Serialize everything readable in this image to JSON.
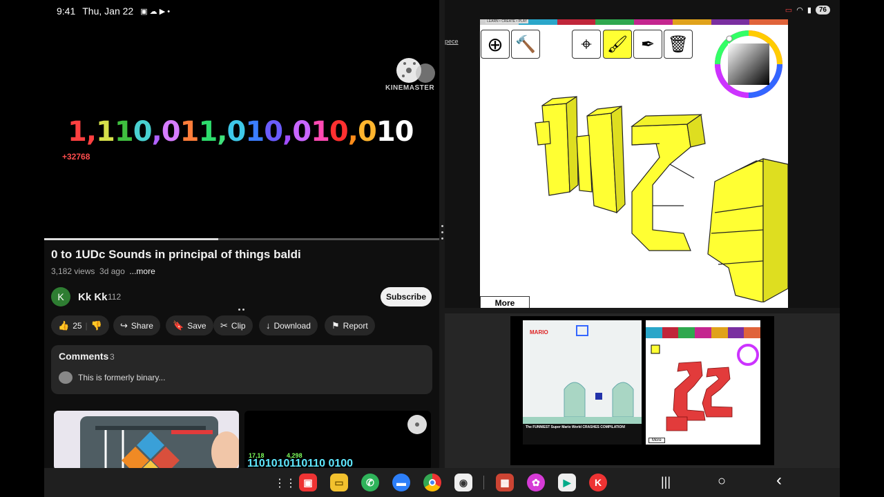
{
  "status_left": {
    "time": "9:41",
    "date": "Thu, Jan 22"
  },
  "status_right": {
    "battery": "76"
  },
  "video": {
    "binary_digits": [
      {
        "t": "1,",
        "c": "#ff4040"
      },
      {
        "t": "1",
        "c": "#d6e04a"
      },
      {
        "t": "1",
        "c": "#3fbf3f"
      },
      {
        "t": "0",
        "c": "#49d0d0"
      },
      {
        "t": ",",
        "c": "#b061ff"
      },
      {
        "t": "0",
        "c": "#d67cff"
      },
      {
        "t": "1",
        "c": "#ff7d3a"
      },
      {
        "t": "1",
        "c": "#2ddc6c"
      },
      {
        "t": ",",
        "c": "#3fe07a"
      },
      {
        "t": "0",
        "c": "#3ec8e8"
      },
      {
        "t": "1",
        "c": "#3b7dff"
      },
      {
        "t": "0",
        "c": "#6a5cff"
      },
      {
        "t": ",",
        "c": "#a14dff"
      },
      {
        "t": "0",
        "c": "#c966ff"
      },
      {
        "t": "1",
        "c": "#ff4ab3"
      },
      {
        "t": "0",
        "c": "#ff3030"
      },
      {
        "t": ",",
        "c": "#ff8c1a"
      },
      {
        "t": "0",
        "c": "#ffb52e"
      },
      {
        "t": "1",
        "c": "#ffffff"
      },
      {
        "t": "0",
        "c": "#ffffff"
      }
    ],
    "sub_value": "+32768",
    "watermark": "KINEMASTER",
    "progress_fraction": 0.44
  },
  "info": {
    "title": "0 to 1UDc Sounds in principal of things baldi",
    "views": "3,182 views",
    "age": "3d ago",
    "more": "...more",
    "channel_initial": "K",
    "channel_name": "Kk Kk",
    "subscriber_count": "112",
    "subscribe_label": "Subscribe"
  },
  "actions": {
    "likes": "25",
    "share": "Share",
    "save": "Save",
    "clip": "Clip",
    "download": "Download",
    "report": "Report"
  },
  "comments": {
    "title": "Comments",
    "count": "3",
    "preview": "This is formerly binary..."
  },
  "thumb2_text": "1101010110110 0100",
  "thumb2_numbers": {
    "a": "17,18",
    "b": "4,298"
  },
  "draw_app": {
    "strip_label": "LEARN • CREATE • PLAY",
    "side_link": "pece",
    "more_label": "More",
    "tools": [
      {
        "icon": "plus-icon",
        "glyph": "⊕"
      },
      {
        "icon": "hammer-icon",
        "glyph": "🔨"
      },
      {
        "icon": "crosshair-icon",
        "glyph": "⊕"
      },
      {
        "icon": "paint-bucket-icon",
        "glyph": "🪣"
      },
      {
        "icon": "eyedropper-icon",
        "glyph": "✎"
      },
      {
        "icon": "trash-icon",
        "glyph": "🗑"
      }
    ],
    "block_color": "#ffff33"
  },
  "mini": {
    "mario_title": "The FUNNIEST Super Mario World CRASHES COMPILATION!",
    "more_label": "More",
    "mini_strip": [
      "MATH",
      "READ",
      "ART",
      "MUSIC",
      "PUZZLE",
      "GAME",
      "TEACHER TOOLS"
    ]
  },
  "nav": {
    "recents": "|||",
    "home": "○",
    "back": "‹"
  }
}
